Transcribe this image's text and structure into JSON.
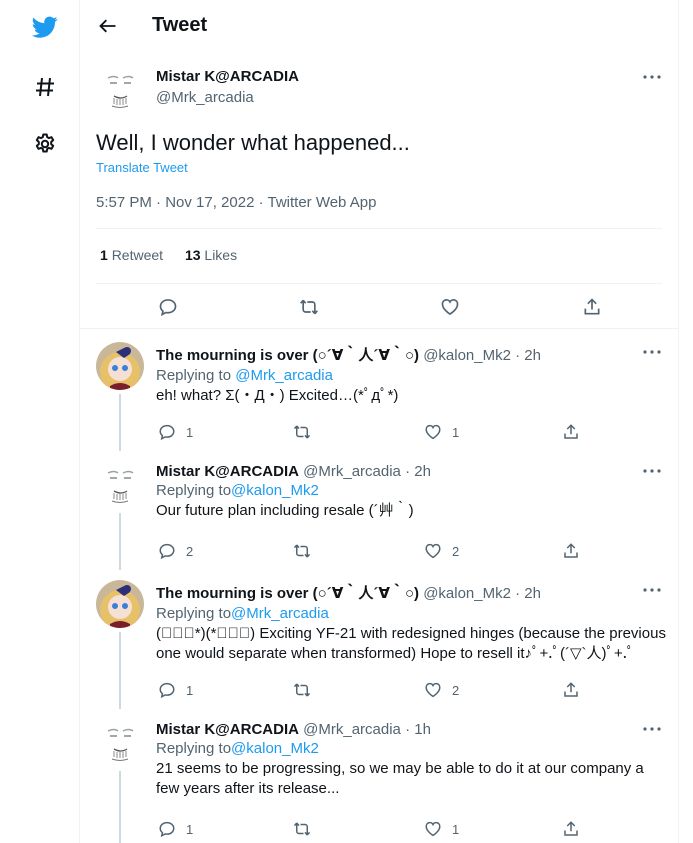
{
  "header": {
    "title": "Tweet"
  },
  "main_tweet": {
    "name": "Mistar K@ARCADIA",
    "handle": "@Mrk_arcadia",
    "text": "Well, I wonder what happened...",
    "translate_label": "Translate Tweet",
    "meta": "5:57 PM · Nov 17, 2022 · Twitter Web App",
    "retweets_count": "1",
    "retweets_label": "Retweet",
    "likes_count": "13",
    "likes_label": "Likes"
  },
  "replies": [
    {
      "name": "The mourning is over (○´∀｀人´∀｀○)",
      "handle_time": "@kalon_Mk2 · 2h",
      "replying_prefix": "Replying to",
      "replying_to": "@Mrk_arcadia",
      "text": "eh! what? Σ(・Д・) Excited…(*ﾟдﾟ*)",
      "reply_count": "1",
      "retweet_count": "",
      "like_count": "1"
    },
    {
      "name": "Mistar K@ARCADIA",
      "handle_time": "@Mrk_arcadia · 2h",
      "replying_prefix": "Replying to",
      "replying_to": "@kalon_Mk2",
      "text": "Our future plan including resale (´艸｀)",
      "reply_count": "2",
      "retweet_count": "",
      "like_count": "2"
    },
    {
      "name": "The mourning is over (○´∀｀人´∀｀○)",
      "handle_time": "@kalon_Mk2 · 2h",
      "replying_prefix": "Replying to",
      "replying_to": "@Mrk_arcadia",
      "text": "(ﾟ∀ﾟ*)(*ﾟ∀ﾟ) Exciting YF-21 with redesigned hinges (because the previous one would separate when transformed) Hope to resell it♪ﾟ+.ﾟ(´▽`人)ﾟ+.ﾟ",
      "reply_count": "1",
      "retweet_count": "",
      "like_count": "2"
    },
    {
      "name": "Mistar K@ARCADIA",
      "handle_time": "@Mrk_arcadia · 1h",
      "replying_prefix": "Replying to",
      "replying_to": "@kalon_Mk2",
      "text": "21 seems to be progressing, so we may be able to do it at our company a few years after its release...",
      "reply_count": "1",
      "retweet_count": "",
      "like_count": "1"
    }
  ],
  "colors": {
    "accent": "#1d9bf0",
    "muted": "#536471",
    "text": "#0f1419",
    "border": "#eff3f4"
  },
  "icons": [
    "twitter-bird-icon",
    "hashtag-icon",
    "gear-icon",
    "back-arrow-icon",
    "more-icon",
    "reply-icon",
    "retweet-icon",
    "like-icon",
    "share-icon"
  ]
}
